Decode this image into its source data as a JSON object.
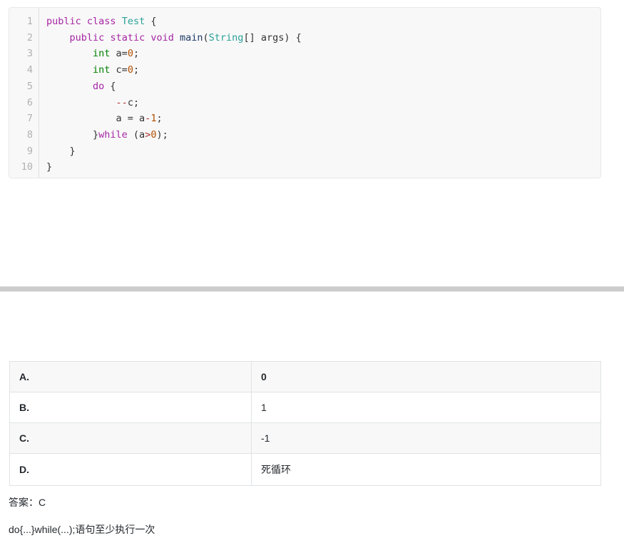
{
  "code_block": {
    "language": "java",
    "lines": [
      {
        "num": "1",
        "tokens": [
          {
            "t": "public",
            "c": "kw"
          },
          {
            "t": " ",
            "c": "pl"
          },
          {
            "t": "class",
            "c": "kw"
          },
          {
            "t": " ",
            "c": "pl"
          },
          {
            "t": "Test",
            "c": "cls"
          },
          {
            "t": " {",
            "c": "pl"
          }
        ]
      },
      {
        "num": "2",
        "tokens": [
          {
            "t": "    ",
            "c": "pl"
          },
          {
            "t": "public",
            "c": "kw"
          },
          {
            "t": " ",
            "c": "pl"
          },
          {
            "t": "static",
            "c": "kw"
          },
          {
            "t": " ",
            "c": "pl"
          },
          {
            "t": "void",
            "c": "kw"
          },
          {
            "t": " ",
            "c": "pl"
          },
          {
            "t": "main",
            "c": "fn"
          },
          {
            "t": "(",
            "c": "pl"
          },
          {
            "t": "String",
            "c": "cls"
          },
          {
            "t": "[] args) {",
            "c": "pl"
          }
        ]
      },
      {
        "num": "3",
        "tokens": [
          {
            "t": "        ",
            "c": "pl"
          },
          {
            "t": "int",
            "c": "type"
          },
          {
            "t": " a=",
            "c": "pl"
          },
          {
            "t": "0",
            "c": "num"
          },
          {
            "t": ";",
            "c": "pl"
          }
        ]
      },
      {
        "num": "4",
        "tokens": [
          {
            "t": "        ",
            "c": "pl"
          },
          {
            "t": "int",
            "c": "type"
          },
          {
            "t": " c=",
            "c": "pl"
          },
          {
            "t": "0",
            "c": "num"
          },
          {
            "t": ";",
            "c": "pl"
          }
        ]
      },
      {
        "num": "5",
        "tokens": [
          {
            "t": "        ",
            "c": "pl"
          },
          {
            "t": "do",
            "c": "kw"
          },
          {
            "t": " {",
            "c": "pl"
          }
        ]
      },
      {
        "num": "6",
        "tokens": [
          {
            "t": "            ",
            "c": "pl"
          },
          {
            "t": "--",
            "c": "op"
          },
          {
            "t": "c;",
            "c": "pl"
          }
        ]
      },
      {
        "num": "7",
        "tokens": [
          {
            "t": "            a = a",
            "c": "pl"
          },
          {
            "t": "-",
            "c": "op"
          },
          {
            "t": "1",
            "c": "num"
          },
          {
            "t": ";",
            "c": "pl"
          }
        ]
      },
      {
        "num": "8",
        "tokens": [
          {
            "t": "        }",
            "c": "pl"
          },
          {
            "t": "while",
            "c": "kw"
          },
          {
            "t": " (a",
            "c": "pl"
          },
          {
            "t": ">",
            "c": "op"
          },
          {
            "t": "0",
            "c": "num"
          },
          {
            "t": ");",
            "c": "pl"
          }
        ]
      },
      {
        "num": "9",
        "tokens": [
          {
            "t": "    }",
            "c": "pl"
          }
        ]
      },
      {
        "num": "10",
        "tokens": [
          {
            "t": "}",
            "c": "pl"
          }
        ]
      }
    ],
    "plain_text": "public class Test {\n    public static void main(String[] args) {\n        int a=0;\n        int c=0;\n        do {\n            --c;\n            a = a-1;\n        }while (a>0);\n    }\n}"
  },
  "options_table": {
    "rows": [
      {
        "key": "A.",
        "value": "0",
        "header": true
      },
      {
        "key": "B.",
        "value": "1",
        "header": false
      },
      {
        "key": "C.",
        "value": "-1",
        "header": false
      },
      {
        "key": "D.",
        "value": "死循环",
        "header": false
      }
    ]
  },
  "answer": {
    "label": "答案：C",
    "explanation": "do{...}while(...);语句至少执行一次"
  },
  "colors": {
    "page_background": "#ffffff",
    "code_background": "#f8f8f8",
    "code_border": "#e8e8e8",
    "gutter_text": "#b1b1b1",
    "divider_bar": "#cccccc",
    "table_border": "#dfe2e5",
    "row_alt_background": "#f8f8f8",
    "text": "#24292e",
    "token_keyword": "#a626a4",
    "token_type": "#008000",
    "token_class": "#2aa198",
    "token_function": "#1f3a68",
    "token_number": "#b35000",
    "token_operator": "#b03030"
  }
}
